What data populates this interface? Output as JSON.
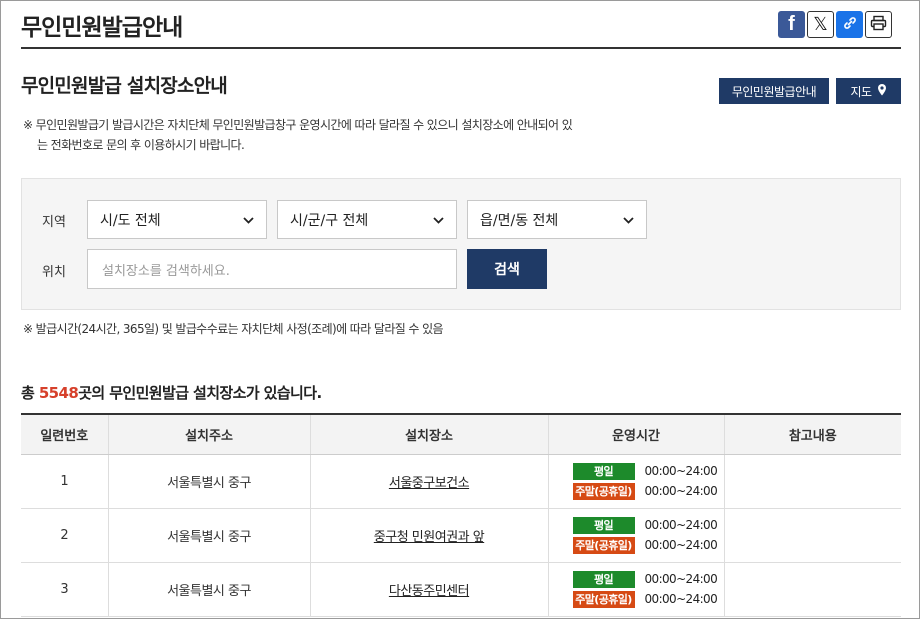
{
  "header": {
    "title": "무인민원발급안내"
  },
  "share": {
    "facebook_icon": "facebook-icon",
    "x_icon": "x-icon",
    "link_icon": "link-icon",
    "print_icon": "print-icon"
  },
  "section": {
    "title": "무인민원발급 설치장소안내",
    "guide_button": "무인민원발급안내",
    "map_button": "지도"
  },
  "notice": {
    "line1": "※ 무인민원발급기 발급시간은 자치단체 무인민원발급창구 운영시간에 따라 달라질 수 있으니 설치장소에 안내되어 있",
    "line2": "는 전화번호로 문의 후 이용하시기 바랍니다."
  },
  "search": {
    "region_label": "지역",
    "location_label": "위치",
    "sido": "시/도 전체",
    "sigungu": "시/군/구 전체",
    "eupmyeondong": "읍/면/동 전체",
    "placeholder": "설치장소를 검색하세요.",
    "button": "검색"
  },
  "note": "※ 발급시간(24시간, 365일) 및 발급수수료는 자치단체 사정(조례)에 따라 달라질 수 있음",
  "total": {
    "prefix": "총 ",
    "count": "5548",
    "suffix": "곳의 무인민원발급 설치장소가 있습니다."
  },
  "table": {
    "headers": [
      "일련번호",
      "설치주소",
      "설치장소",
      "운영시간",
      "참고내용"
    ],
    "weekday_label": "평일",
    "weekend_label": "주말(공휴일)",
    "rows": [
      {
        "no": "1",
        "address": "서울특별시 중구",
        "place": "서울중구보건소",
        "weekday": "00:00~24:00",
        "weekend": "00:00~24:00",
        "note": ""
      },
      {
        "no": "2",
        "address": "서울특별시 중구",
        "place": "중구청 민원여권과 앞",
        "weekday": "00:00~24:00",
        "weekend": "00:00~24:00",
        "note": ""
      },
      {
        "no": "3",
        "address": "서울특별시 중구",
        "place": "다산동주민센터",
        "weekday": "00:00~24:00",
        "weekend": "00:00~24:00",
        "note": ""
      }
    ]
  }
}
